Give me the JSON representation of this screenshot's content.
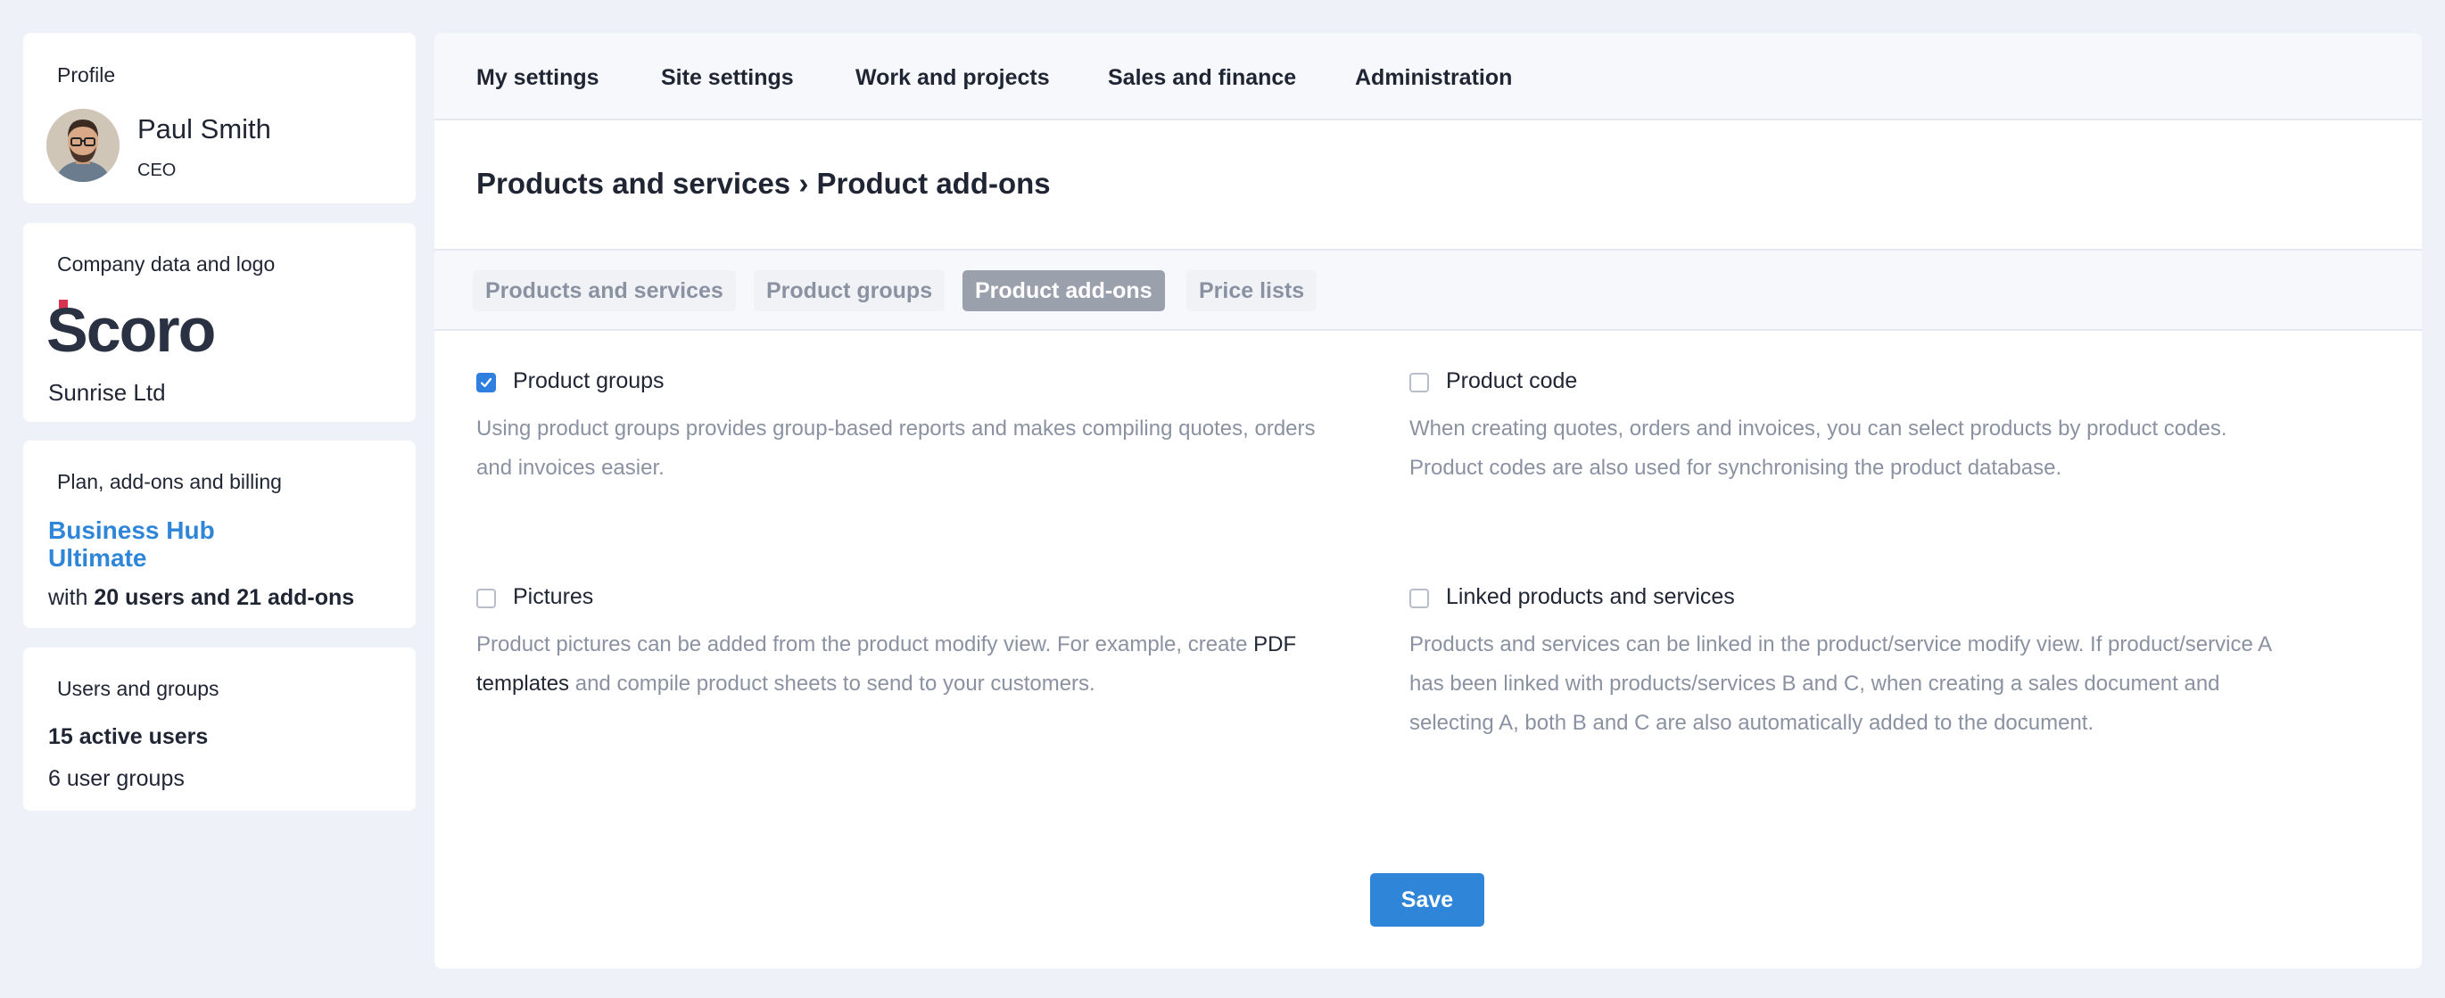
{
  "sidebar": {
    "profile": {
      "title": "Profile",
      "name": "Paul Smith",
      "role": "CEO"
    },
    "company": {
      "title": "Company data and logo",
      "logo_text": "Scoro",
      "name": "Sunrise Ltd"
    },
    "plan": {
      "title": "Plan, add-ons and billing",
      "plan_line1": "Business Hub",
      "plan_line2": "Ultimate",
      "details_prefix": "with ",
      "details_bold": "20 users and 21 add-ons"
    },
    "users": {
      "title": "Users and groups",
      "active": "15 active users",
      "groups": "6 user groups"
    }
  },
  "topnav": {
    "items": [
      "My settings",
      "Site settings",
      "Work and projects",
      "Sales and finance",
      "Administration"
    ]
  },
  "page": {
    "title": "Products and services › Product add-ons"
  },
  "subnav": {
    "tabs": [
      "Products and services",
      "Product groups",
      "Product add-ons",
      "Price lists"
    ],
    "active": "Product add-ons"
  },
  "options": [
    {
      "label": "Product groups",
      "checked": true,
      "description": "Using product groups provides group-based reports and makes compiling quotes, orders and invoices easier."
    },
    {
      "label": "Product code",
      "checked": false,
      "description": "When creating quotes, orders and invoices, you can select products by product codes. Product codes are also used for synchronising the product database."
    },
    {
      "label": "Pictures",
      "checked": false,
      "description_before": "Product pictures can be added from the product modify view. For example, create ",
      "description_link": "PDF templates",
      "description_after": " and compile product sheets to send to your customers."
    },
    {
      "label": "Linked products and services",
      "checked": false,
      "description": "Products and services can be linked in the product/service modify view. If product/service A has been linked with products/services B and C, when creating a sales document and selecting A, both B and C are also automatically added to the document."
    }
  ],
  "actions": {
    "save_label": "Save"
  },
  "colors": {
    "accent": "#2f86d8",
    "checkbox_checked": "#2f7fe0",
    "logo_mark": "#d9324f",
    "logo_text": "#2a3142"
  }
}
